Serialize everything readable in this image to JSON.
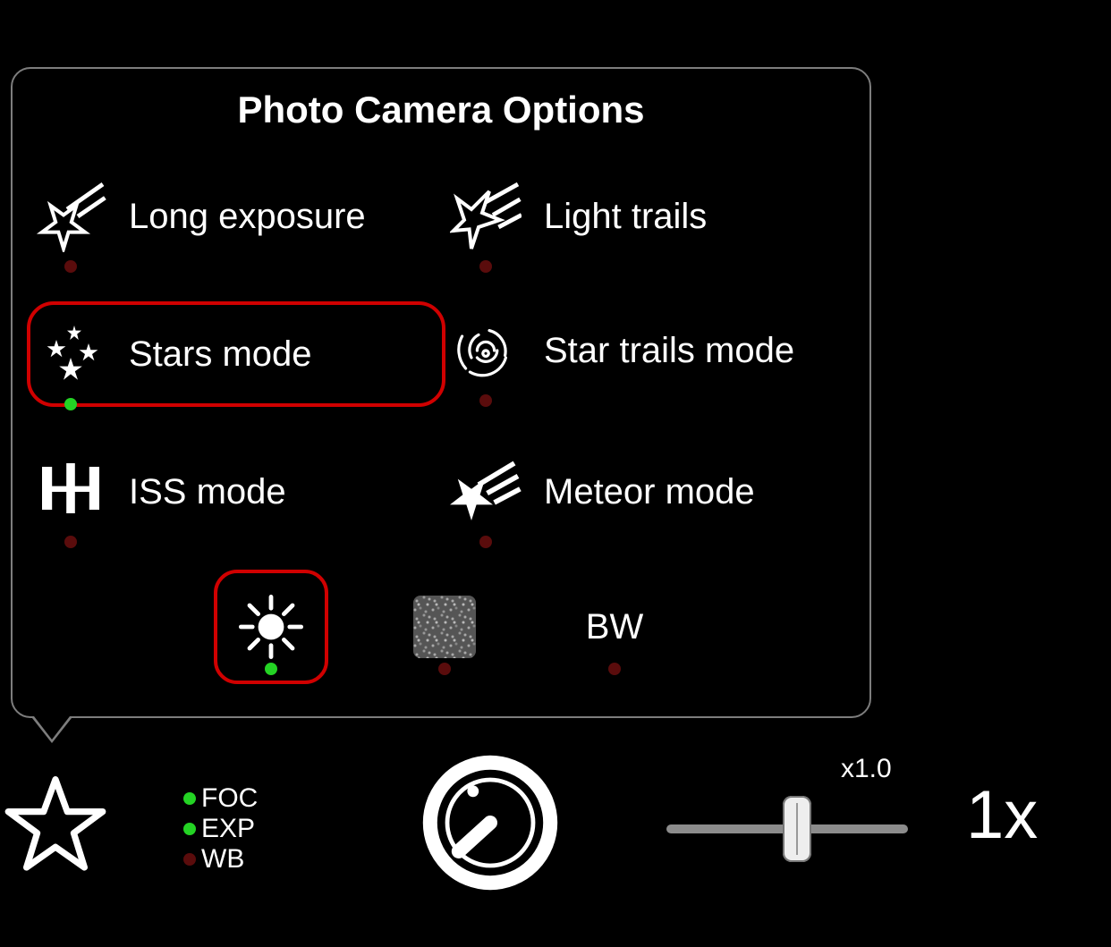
{
  "popup": {
    "title": "Photo Camera Options",
    "modes": [
      {
        "id": "long-exposure",
        "label": "Long exposure",
        "status": "red",
        "selected": false
      },
      {
        "id": "light-trails",
        "label": "Light trails",
        "status": "red",
        "selected": false
      },
      {
        "id": "stars-mode",
        "label": "Stars mode",
        "status": "green",
        "selected": true
      },
      {
        "id": "star-trails",
        "label": "Star trails mode",
        "status": "red",
        "selected": false
      },
      {
        "id": "iss-mode",
        "label": "ISS mode",
        "status": "red",
        "selected": false
      },
      {
        "id": "meteor-mode",
        "label": "Meteor mode",
        "status": "red",
        "selected": false
      }
    ],
    "sub_options": [
      {
        "id": "brightness",
        "label": "",
        "status": "green",
        "selected": true
      },
      {
        "id": "noise",
        "label": "",
        "status": "red",
        "selected": false
      },
      {
        "id": "bw",
        "label": "BW",
        "status": "red",
        "selected": false
      }
    ]
  },
  "toolbar": {
    "indicators": [
      {
        "label": "FOC",
        "color": "green"
      },
      {
        "label": "EXP",
        "color": "green"
      },
      {
        "label": "WB",
        "color": "red"
      }
    ],
    "slider_value_label": "x1.0",
    "zoom_label": "1x"
  }
}
